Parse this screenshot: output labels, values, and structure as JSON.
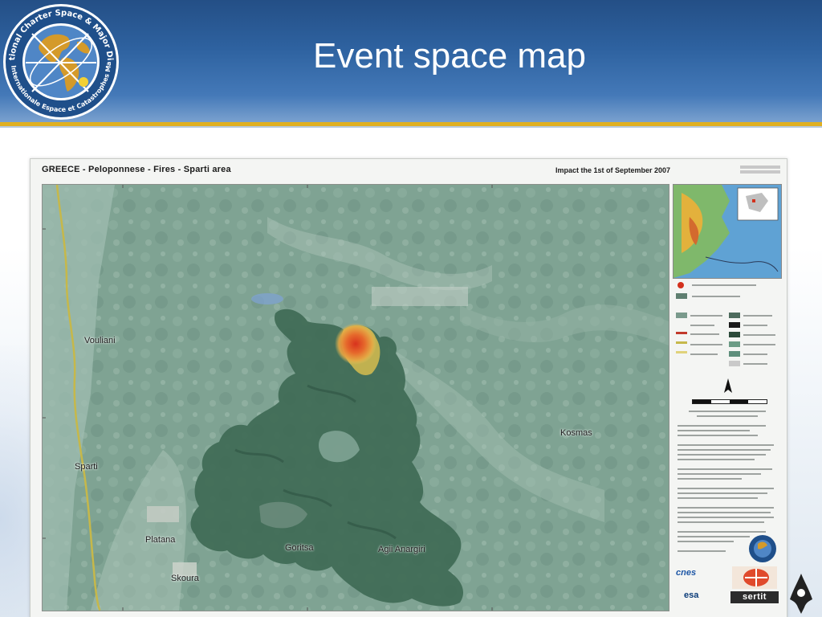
{
  "slide": {
    "title": "Event space map",
    "logo": {
      "icon": "charter-globe-logo-icon",
      "ring_text_top": "International Charter Space & Major Disasters",
      "ring_text_bottom": "Charte Internationale Espace et Catastrophes Majeures"
    },
    "colors": {
      "header_blue": "#2e62a0",
      "accent_gold": "#e0b021"
    }
  },
  "map": {
    "title": "GREECE - Peloponnese - Fires - Sparti area",
    "impact_text": "Impact the 1st of September 2007",
    "place_labels": [
      "Vouliani",
      "Sparti",
      "Kosmas",
      "Platana",
      "Goritsa",
      "Agii Anargiri",
      "Skoura"
    ],
    "logos": {
      "cnes": "cnes",
      "esa": "esa",
      "sertit": "sertit"
    },
    "colors": {
      "burnt_area": "#3f6a55",
      "active_fire": "#e0582a",
      "river_line": "#c6b84a"
    }
  }
}
